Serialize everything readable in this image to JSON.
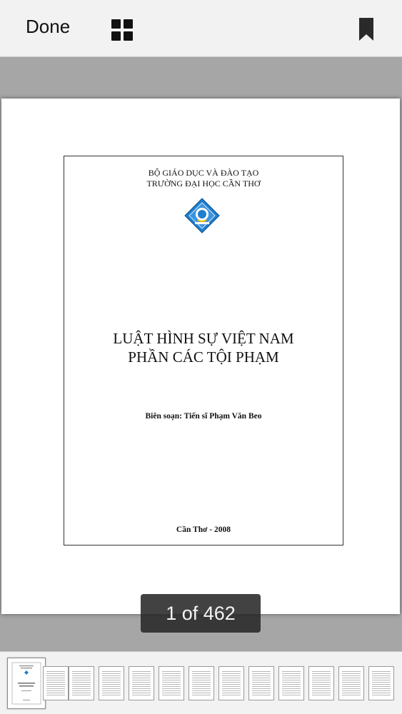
{
  "toolbar": {
    "done_label": "Done",
    "grid_icon": "grid-icon",
    "bookmark_icon": "bookmark-icon"
  },
  "document": {
    "ministry": "BỘ GIÁO DỤC VÀ ĐÀO TẠO",
    "university": "TRƯỜNG ĐẠI HỌC CẦN THƠ",
    "title_line1": "LUẬT HÌNH SỰ VIỆT NAM",
    "title_line2": "PHẦN CÁC TỘI PHẠM",
    "author": "Biên soạn: Tiến sĩ Phạm Văn Beo",
    "place_year": "Cần Thơ - 2008"
  },
  "page_indicator": "1 of 462",
  "colors": {
    "toolbar_bg": "#f2f2f2",
    "viewer_bg": "#a6a6a6",
    "indicator_bg": "#282828",
    "logo_blue": "#1e7fd0"
  }
}
